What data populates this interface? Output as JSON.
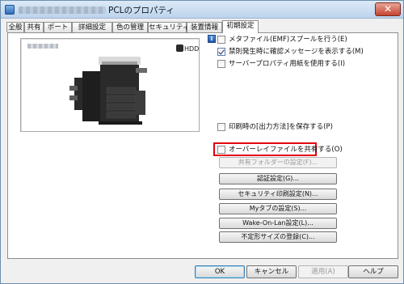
{
  "window": {
    "title": "PCLのプロパティ",
    "close_glyph": "✕"
  },
  "tabs": [
    {
      "label": "全般"
    },
    {
      "label": "共有"
    },
    {
      "label": "ポート"
    },
    {
      "label": "詳細設定"
    },
    {
      "label": "色の管理"
    },
    {
      "label": "セキュリティ"
    },
    {
      "label": "装置情報"
    },
    {
      "label": "初期設定",
      "active": true
    }
  ],
  "preview": {
    "hdd_label": "HDD",
    "device_colors": {
      "body": "#2a2a2a",
      "panel": "#6a6a6a",
      "light": "#d9d9d9"
    }
  },
  "info_icon": {
    "glyph": "i"
  },
  "options": [
    {
      "label": "メタファイル(EMF)スプールを行う(E)",
      "checked": false,
      "enabled": true
    },
    {
      "label": "禁則発生時に確認メッセージを表示する(M)",
      "checked": true,
      "enabled": true
    },
    {
      "label": "サーバープロパティ用紙を使用する(I)",
      "checked": false,
      "enabled": true
    },
    {
      "label": "印刷時の[出力方法]を保存する(P)",
      "checked": false,
      "enabled": true
    },
    {
      "label": "オーバーレイファイルを共有する(O)",
      "checked": false,
      "enabled": true
    }
  ],
  "buttons": {
    "shared_folder": "共有フォルダーの設定(F)...",
    "auth_settings": "認証設定(G)...",
    "security_print": "セキュリティ印刷設定(N)...",
    "my_tab": "Myタブの設定(S)...",
    "wake_on_lan": "Wake-On-Lan設定(L)...",
    "custom_size": "不定形サイズの登録(C)..."
  },
  "footer": {
    "ok": "OK",
    "cancel": "キャンセル",
    "apply": "適用(A)",
    "help": "ヘルプ"
  },
  "colors": {
    "highlight": "#e3000f",
    "title_gradient_top": "#dceaf8",
    "title_gradient_bottom": "#bcd3ec"
  }
}
